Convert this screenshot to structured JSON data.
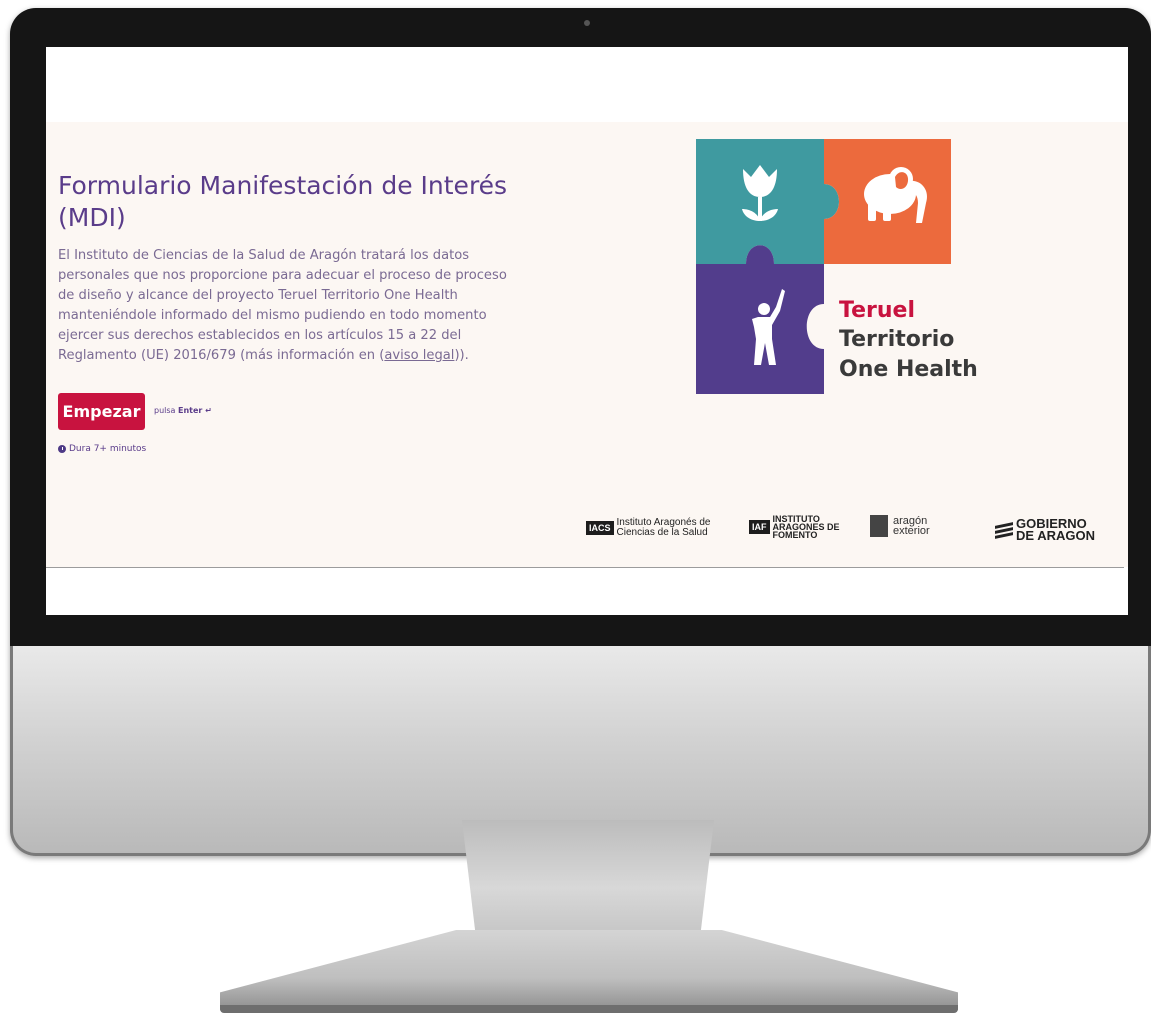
{
  "form": {
    "title": "Formulario Manifestación de Interés (MDI)",
    "description_before_link": "El Instituto de Ciencias de la Salud de Aragón tratará los datos personales que nos proporcione para adecuar el proceso de proceso de diseño y alcance del proyecto Teruel Territorio One Health manteniéndole informado del mismo pudiendo en todo momento ejercer sus derechos establecidos en los artículos 15 a 22 del Reglamento (UE) 2016/679 (más información en (",
    "description_link": "aviso legal",
    "description_after_link": ")).",
    "start_button": "Empezar",
    "press_hint_prefix": "pulsa",
    "press_hint_key": "Enter ↵",
    "duration": "Dura 7+ minutos"
  },
  "logo": {
    "line1": "Teruel",
    "line2": "Territorio",
    "line3": "One Health"
  },
  "partners": {
    "iacs_badge": "IACS",
    "iacs_line1": "Instituto Aragonés de",
    "iacs_line2": "Ciencias de la Salud",
    "iaf_badge": "IAF",
    "iaf_line1": "INSTITUTO",
    "iaf_line2": "ARAGONES DE",
    "iaf_line3": "FOMENTO",
    "arex_line1": "aragón",
    "arex_line2": "exterior",
    "gob_line1": "GOBIERNO",
    "gob_line2": "DE ARAGON"
  },
  "colors": {
    "accent": "#c8133f",
    "purple": "#5a3c8a",
    "teal": "#3f9aa0",
    "orange": "#ec6a3d",
    "puzzle_purple": "#523d8c",
    "hero_bg": "#fcf7f3"
  }
}
